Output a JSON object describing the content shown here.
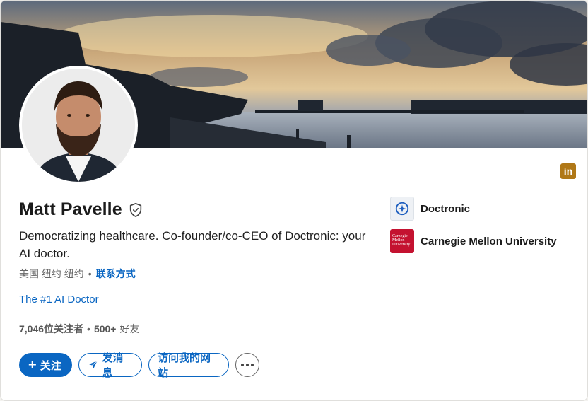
{
  "profile": {
    "name": "Matt Pavelle",
    "headline": "Democratizing healthcare. Co-founder/co-CEO of Doctronic: your AI doctor.",
    "location": "美国 纽约 纽约",
    "contact_label": "联系方式",
    "website_label": "The #1 AI Doctor",
    "followers_count": "7,046",
    "followers_label": "位关注者",
    "connections_count": "500+",
    "connections_label": "好友"
  },
  "badge": {
    "label": "in"
  },
  "actions": {
    "follow_label": "关注",
    "message_label": "发消息",
    "website_label": "访问我的网站"
  },
  "orgs": [
    {
      "name": "Doctronic",
      "icon": "doctronic-logo-icon"
    },
    {
      "name": "Carnegie Mellon University",
      "icon": "cmu-logo-icon",
      "logo_text": "Carnegie Mellon University"
    }
  ],
  "colors": {
    "link": "#0a66c2",
    "badge": "#b07817",
    "cmu": "#c41230"
  }
}
